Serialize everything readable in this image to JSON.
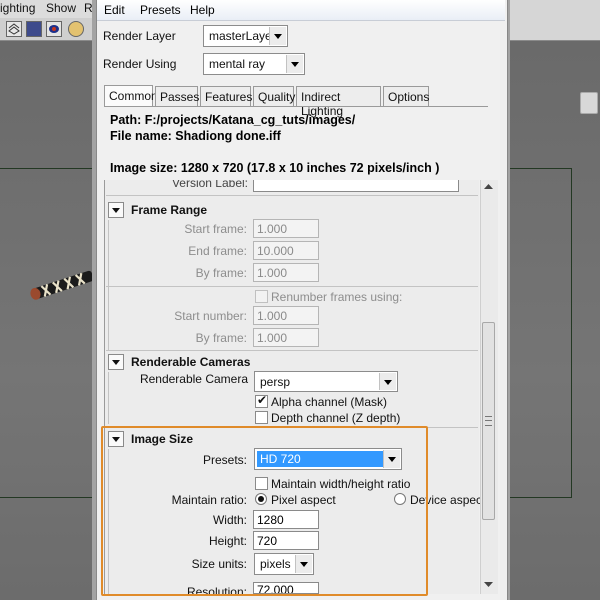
{
  "background_app": {
    "menu": [
      "ighting",
      "Show",
      "R"
    ]
  },
  "dialog": {
    "menu": [
      "Edit",
      "Presets",
      "Help"
    ],
    "render_layer": {
      "label": "Render Layer",
      "value": "masterLayer"
    },
    "render_using": {
      "label": "Render Using",
      "value": "mental ray"
    },
    "tabs": [
      "Common",
      "Passes",
      "Features",
      "Quality",
      "Indirect Lighting",
      "Options"
    ],
    "info": {
      "path": "Path: F:/projects/Katana_cg_tuts/images/",
      "file_name": "File name:  Shadiong done.iff",
      "image_size": "Image size: 1280 x 720 (17.8 x 10 inches 72 pixels/inch )"
    },
    "version_label": "Version Label:",
    "frame_range": {
      "title": "Frame Range",
      "start_label": "Start frame:",
      "start_value": "1.000",
      "end_label": "End frame:",
      "end_value": "10.000",
      "by_label": "By frame:",
      "by_value": "1.000",
      "renumber_label": "Renumber frames using:",
      "start_number_label": "Start number:",
      "start_number_value": "1.000",
      "by_frame2_label": "By frame:",
      "by_frame2_value": "1.000"
    },
    "renderable_cameras": {
      "title": "Renderable Cameras",
      "camera_label": "Renderable Camera",
      "camera_value": "persp",
      "alpha_label": "Alpha channel (Mask)",
      "depth_label": "Depth channel (Z depth)"
    },
    "image_size": {
      "title": "Image Size",
      "presets_label": "Presets:",
      "presets_value": "HD 720",
      "maintain_wh_label": "Maintain width/height ratio",
      "maintain_ratio_label": "Maintain ratio:",
      "pixel_aspect_label": "Pixel aspect",
      "device_aspect_label": "Device aspect",
      "width_label": "Width:",
      "width_value": "1280",
      "height_label": "Height:",
      "height_value": "720",
      "size_units_label": "Size units:",
      "size_units_value": "pixels",
      "resolution_label": "Resolution:",
      "resolution_value": "72.000"
    }
  },
  "colors": {
    "highlight": "#e08b2a",
    "preset_selection": "#3399ff"
  }
}
